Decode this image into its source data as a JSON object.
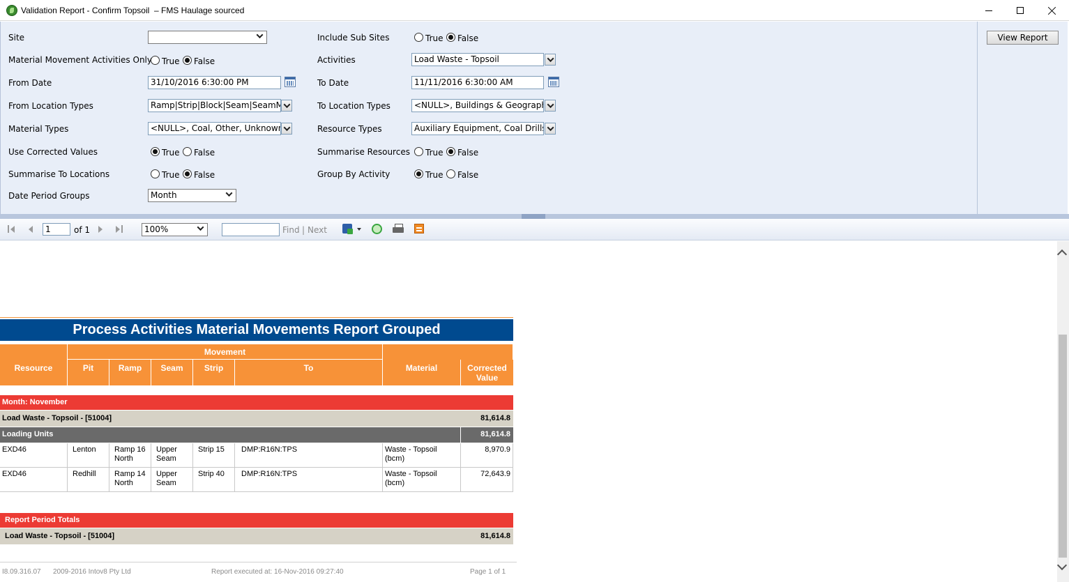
{
  "window": {
    "title": "Validation Report - Confirm Topsoil  – FMS Haulage sourced"
  },
  "params": {
    "view_report_label": "View Report",
    "site": {
      "label": "Site",
      "value": ""
    },
    "include_sub_sites": {
      "label": "Include Sub Sites",
      "true_label": "True",
      "false_label": "False",
      "selected": "False"
    },
    "material_movement_only": {
      "label": "Material Movement Activities Only",
      "true_label": "True",
      "false_label": "False",
      "selected": "False"
    },
    "activities": {
      "label": "Activities",
      "value": "Load Waste - Topsoil"
    },
    "from_date": {
      "label": "From Date",
      "value": "31/10/2016 6:30:00 PM"
    },
    "to_date": {
      "label": "To Date",
      "value": "11/11/2016 6:30:00 AM"
    },
    "from_location_types": {
      "label": "From Location Types",
      "value": "Ramp|Strip|Block|Seam|SeamM"
    },
    "to_location_types": {
      "label": "To Location Types",
      "value": "<NULL>, Buildings & Geographic"
    },
    "material_types": {
      "label": "Material Types",
      "value": "<NULL>, Coal, Other, Unknown,"
    },
    "resource_types": {
      "label": "Resource Types",
      "value": "Auxiliary Equipment, Coal Drills,"
    },
    "use_corrected_values": {
      "label": "Use Corrected Values",
      "true_label": "True",
      "false_label": "False",
      "selected": "True"
    },
    "summarise_resources": {
      "label": "Summarise Resources",
      "true_label": "True",
      "false_label": "False",
      "selected": "False"
    },
    "summarise_to_locations": {
      "label": "Summarise To Locations",
      "true_label": "True",
      "false_label": "False",
      "selected": "False"
    },
    "group_by_activity": {
      "label": "Group By Activity",
      "true_label": "True",
      "false_label": "False",
      "selected": "True"
    },
    "date_period_groups": {
      "label": "Date Period Groups",
      "value": "Month"
    }
  },
  "toolbar": {
    "page": "1",
    "of_pages": "of 1",
    "zoom": "100%",
    "find_label": "Find",
    "separator": "|",
    "next_label": "Next"
  },
  "report": {
    "title": "Process Activities Material Movements Report Grouped",
    "movement_header": "Movement",
    "columns": {
      "resource": "Resource",
      "pit": "Pit",
      "ramp": "Ramp",
      "seam": "Seam",
      "strip": "Strip",
      "to": "To",
      "material": "Material",
      "corrected_value": "Corrected Value"
    },
    "month_group": "Month: November",
    "activity_group": {
      "label": "Load Waste - Topsoil - [51004]",
      "total": "81,614.8"
    },
    "loading_units": {
      "label": "Loading Units",
      "total": "81,614.8"
    },
    "rows": [
      {
        "resource": "EXD46",
        "pit": "Lenton",
        "ramp": "Ramp 16 North",
        "seam": "Upper Seam",
        "strip": "Strip 15",
        "to": "DMP:R16N:TPS",
        "material": "Waste - Topsoil (bcm)",
        "value": "8,970.9"
      },
      {
        "resource": "EXD46",
        "pit": "Redhill",
        "ramp": "Ramp 14 North",
        "seam": "Upper Seam",
        "strip": "Strip 40",
        "to": "DMP:R16N:TPS",
        "material": "Waste - Topsoil (bcm)",
        "value": "72,643.9"
      }
    ],
    "period_totals": {
      "label": "Report Period Totals",
      "activity": "Load Waste - Topsoil - [51004]",
      "total": "81,614.8"
    },
    "footer": {
      "version": "I8.09.316.07",
      "copyright": "2009-2016 Intov8 Pty Ltd",
      "executed": "Report executed at: 16-Nov-2016 09:27:40",
      "page": "Page 1 of 1"
    }
  },
  "colors": {
    "title_bg": "#004a8f",
    "header_bg": "#f79238",
    "group_red": "#ec3b34",
    "group_tan": "#d6d2c6",
    "group_dark": "#6a6a6a",
    "params_bg": "#e8eef8"
  }
}
